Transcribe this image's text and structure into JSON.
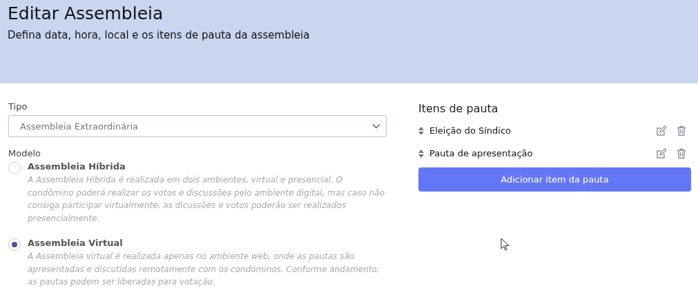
{
  "header": {
    "title": "Editar Assembleia",
    "subtitle": "Defina data, hora, local e os itens de pauta da assembleia"
  },
  "tipo": {
    "label": "Tipo",
    "value": "Assembleia Extraordinária"
  },
  "modelo": {
    "label": "Modelo",
    "options": [
      {
        "title": "Assembleia Híbrida",
        "description": "A Assembleia Híbrida é realizada em dois ambientes, virtual e presencial. O condômino poderá realizar os votos e discussões pelo ambiente digital, mas caso não consiga participar virtualmente, as dicussões e votos poderão ser realizados presencialmente.",
        "selected": false
      },
      {
        "title": "Assembleia Virtual",
        "description": "A Assembleia virtual é realizada apenas no ambiente web, onde as pautas são apresentadas e discutidas remotamente com os condôminos. Conforme andamento, as pautas podem ser liberadas para votação.",
        "selected": true
      }
    ]
  },
  "pauta": {
    "title": "Itens de pauta",
    "items": [
      {
        "label": "Eleição do Síndico"
      },
      {
        "label": "Pauta de apresentação"
      }
    ],
    "add_button": "Adicionar item da pauta"
  }
}
